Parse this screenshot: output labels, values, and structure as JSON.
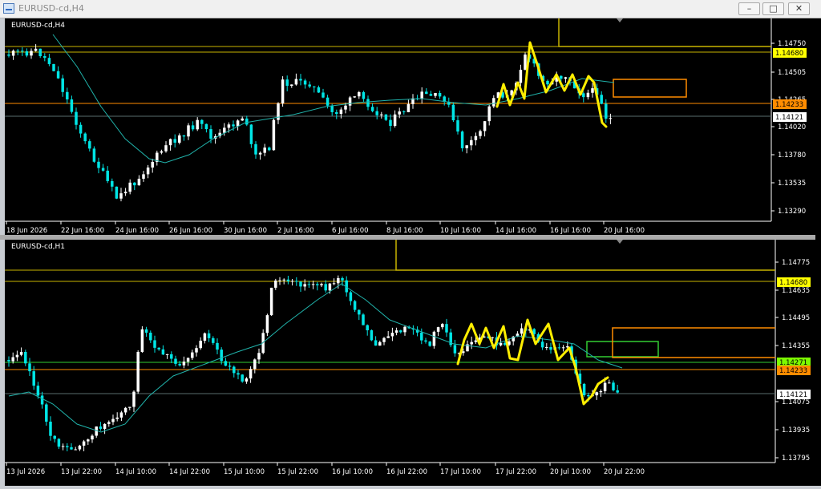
{
  "window": {
    "title": "EURUSD-cd,H4",
    "buttons": [
      {
        "name": "minimize-button",
        "glyph": "–"
      },
      {
        "name": "maximize-button",
        "glyph": "□"
      },
      {
        "name": "close-button",
        "glyph": "✕"
      }
    ]
  },
  "charts": [
    {
      "id": "h4",
      "symbol_label": "EURUSD-cd,H4",
      "price_levels": [
        "1.14750",
        "1.14505",
        "1.14265",
        "1.14020",
        "1.13780",
        "1.13535",
        "1.13290"
      ],
      "time_labels": [
        "18 Jun 2026",
        "22 Jun 16:00",
        "24 Jun 16:00",
        "26 Jun 16:00",
        "30 Jun 16:00",
        "2 Jul 16:00",
        "6 Jul 16:00",
        "8 Jul 16:00",
        "10 Jul 16:00",
        "14 Jul 16:00",
        "16 Jul 16:00",
        "20 Jul 16:00"
      ],
      "tags": [
        {
          "text": "1.14680",
          "bg": "#ffff00",
          "fg": "#000000"
        },
        {
          "text": "1.14233",
          "bg": "#ff8c00",
          "fg": "#000000"
        },
        {
          "text": "1.14121",
          "bg": "#ffffff",
          "fg": "#000000"
        }
      ]
    },
    {
      "id": "h1",
      "symbol_label": "EURUSD-cd,H1",
      "price_levels": [
        "1.14775",
        "1.14635",
        "1.14495",
        "1.14355",
        "1.14075",
        "1.13935",
        "1.13795"
      ],
      "time_labels": [
        "13 Jul 2026",
        "13 Jul 22:00",
        "14 Jul 10:00",
        "14 Jul 22:00",
        "15 Jul 10:00",
        "15 Jul 22:00",
        "16 Jul 10:00",
        "16 Jul 22:00",
        "17 Jul 10:00",
        "17 Jul 22:00",
        "20 Jul 10:00",
        "20 Jul 22:00"
      ],
      "tags": [
        {
          "text": "1.14680",
          "bg": "#ffff00",
          "fg": "#000000"
        },
        {
          "text": "1.14271",
          "bg": "#7cfc00",
          "fg": "#000000"
        },
        {
          "text": "1.14233",
          "bg": "#ff8c00",
          "fg": "#000000"
        },
        {
          "text": "1.14121",
          "bg": "#ffffff",
          "fg": "#000000"
        }
      ]
    }
  ],
  "colors": {
    "candle": "#00e5e5",
    "bull_candle": "#ffffff",
    "moving_average": "#20b2aa",
    "drawing": "#ffee00",
    "resistance": "#c8b400",
    "support": "#ff8c00",
    "zone_green": "#32cd32"
  }
}
